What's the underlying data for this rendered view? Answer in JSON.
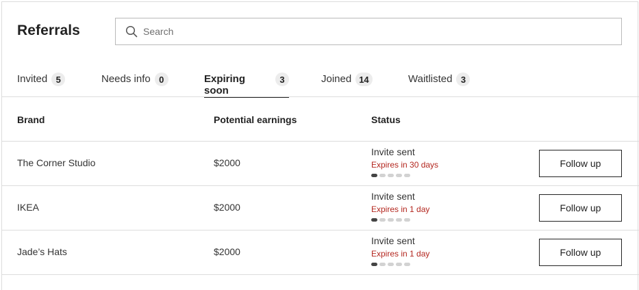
{
  "header": {
    "title": "Referrals",
    "search": {
      "placeholder": "Search",
      "value": ""
    }
  },
  "tabs": [
    {
      "label": "Invited",
      "count": "5",
      "active": false
    },
    {
      "label": "Needs info",
      "count": "0",
      "active": false
    },
    {
      "label": "Expiring soon",
      "count": "3",
      "active": true
    },
    {
      "label": "Joined",
      "count": "14",
      "active": false
    },
    {
      "label": "Waitlisted",
      "count": "3",
      "active": false
    }
  ],
  "table": {
    "columns": [
      "Brand",
      "Potential earnings",
      "Status"
    ],
    "rows": [
      {
        "brand": "The Corner Studio",
        "earnings": "$2000",
        "status": "Invite sent",
        "expiry": "Expires in 30 days",
        "progress_steps_total": 5,
        "progress_steps_done": 1,
        "action": "Follow up"
      },
      {
        "brand": "IKEA",
        "earnings": "$2000",
        "status": "Invite sent",
        "expiry": "Expires in 1 day",
        "progress_steps_total": 5,
        "progress_steps_done": 1,
        "action": "Follow up"
      },
      {
        "brand": "Jade’s Hats",
        "earnings": "$2000",
        "status": "Invite sent",
        "expiry": "Expires in 1 day",
        "progress_steps_total": 5,
        "progress_steps_done": 1,
        "action": "Follow up"
      }
    ]
  },
  "colors": {
    "expiry_text": "#b3261e",
    "progress_done": "#444444",
    "progress_todo": "#d2d2d2",
    "border": "#dcdcdc"
  },
  "icons": {
    "search": "search-icon"
  }
}
